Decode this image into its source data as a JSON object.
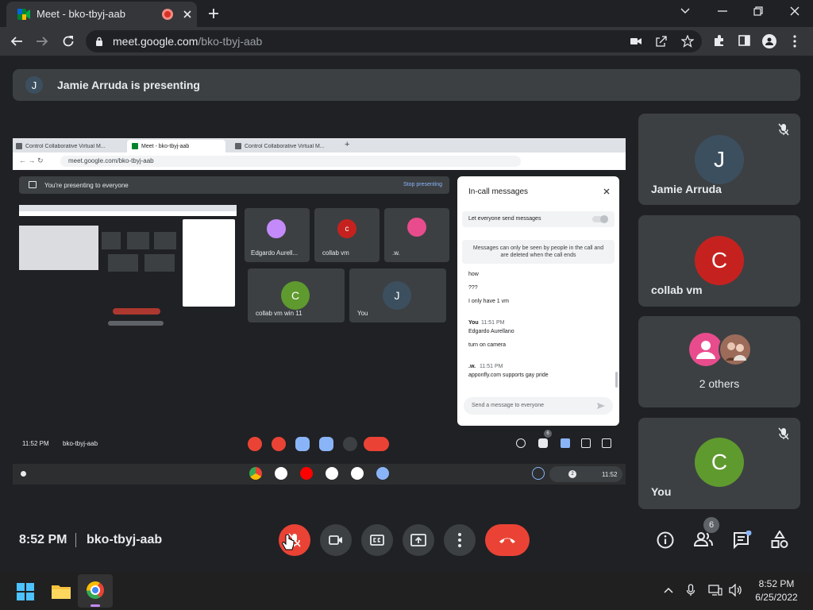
{
  "browser": {
    "tab_title": "Meet - bko-tbyj-aab",
    "url_domain": "meet.google.com",
    "url_path": "/bko-tbyj-aab"
  },
  "meet": {
    "banner_initial": "J",
    "banner_text": "Jamie Arruda is presenting",
    "time": "8:52 PM",
    "meeting_code": "bko-tbyj-aab",
    "people_count": "6",
    "tiles": [
      {
        "initial": "J",
        "name": "Jamie Arruda",
        "color": "#3c4f5f"
      },
      {
        "initial": "C",
        "name": "collab vm",
        "color": "#c5221f"
      },
      {
        "name": "2 others"
      },
      {
        "initial": "C",
        "name": "You",
        "color": "#5f9a2e"
      }
    ]
  },
  "inner": {
    "tabs": [
      "Control Collaborative Virtual M...",
      "Meet - bko-tbyj-aab",
      "Control Collaborative Virtual M..."
    ],
    "url": "meet.google.com/bko-tbyj-aab",
    "presenting_text": "You're presenting to everyone",
    "stop_presenting": "Stop presenting",
    "tiles": [
      {
        "name": "Edgardo Aurell...",
        "initial": ""
      },
      {
        "name": "collab vm",
        "initial": "c"
      },
      {
        "name": ".w.",
        "initial": ""
      },
      {
        "name": "collab vm win 11",
        "initial": "C"
      },
      {
        "name": "You",
        "initial": "J"
      }
    ],
    "time": "11:52 PM",
    "code": "bko-tbyj-aab",
    "people_badge": "6",
    "shelf_time": "11:52",
    "shelf_badge": "2"
  },
  "chat": {
    "title": "In-call messages",
    "toggle_label": "Let everyone send messages",
    "notice": "Messages can only be seen by people in the call and are deleted when the call ends",
    "messages": [
      {
        "text": "how"
      },
      {
        "text": "???"
      },
      {
        "text": "I only have 1 vm"
      },
      {
        "sender": "You",
        "time": "11:51 PM",
        "text": "Edgardo Aurellano"
      },
      {
        "text": "turn on camera"
      },
      {
        "sender": ".w.",
        "time": "11:51 PM",
        "text": "apponfly.com supports gay pride"
      }
    ],
    "input_placeholder": "Send a message to everyone"
  },
  "taskbar": {
    "time": "8:52 PM",
    "date": "6/25/2022"
  }
}
